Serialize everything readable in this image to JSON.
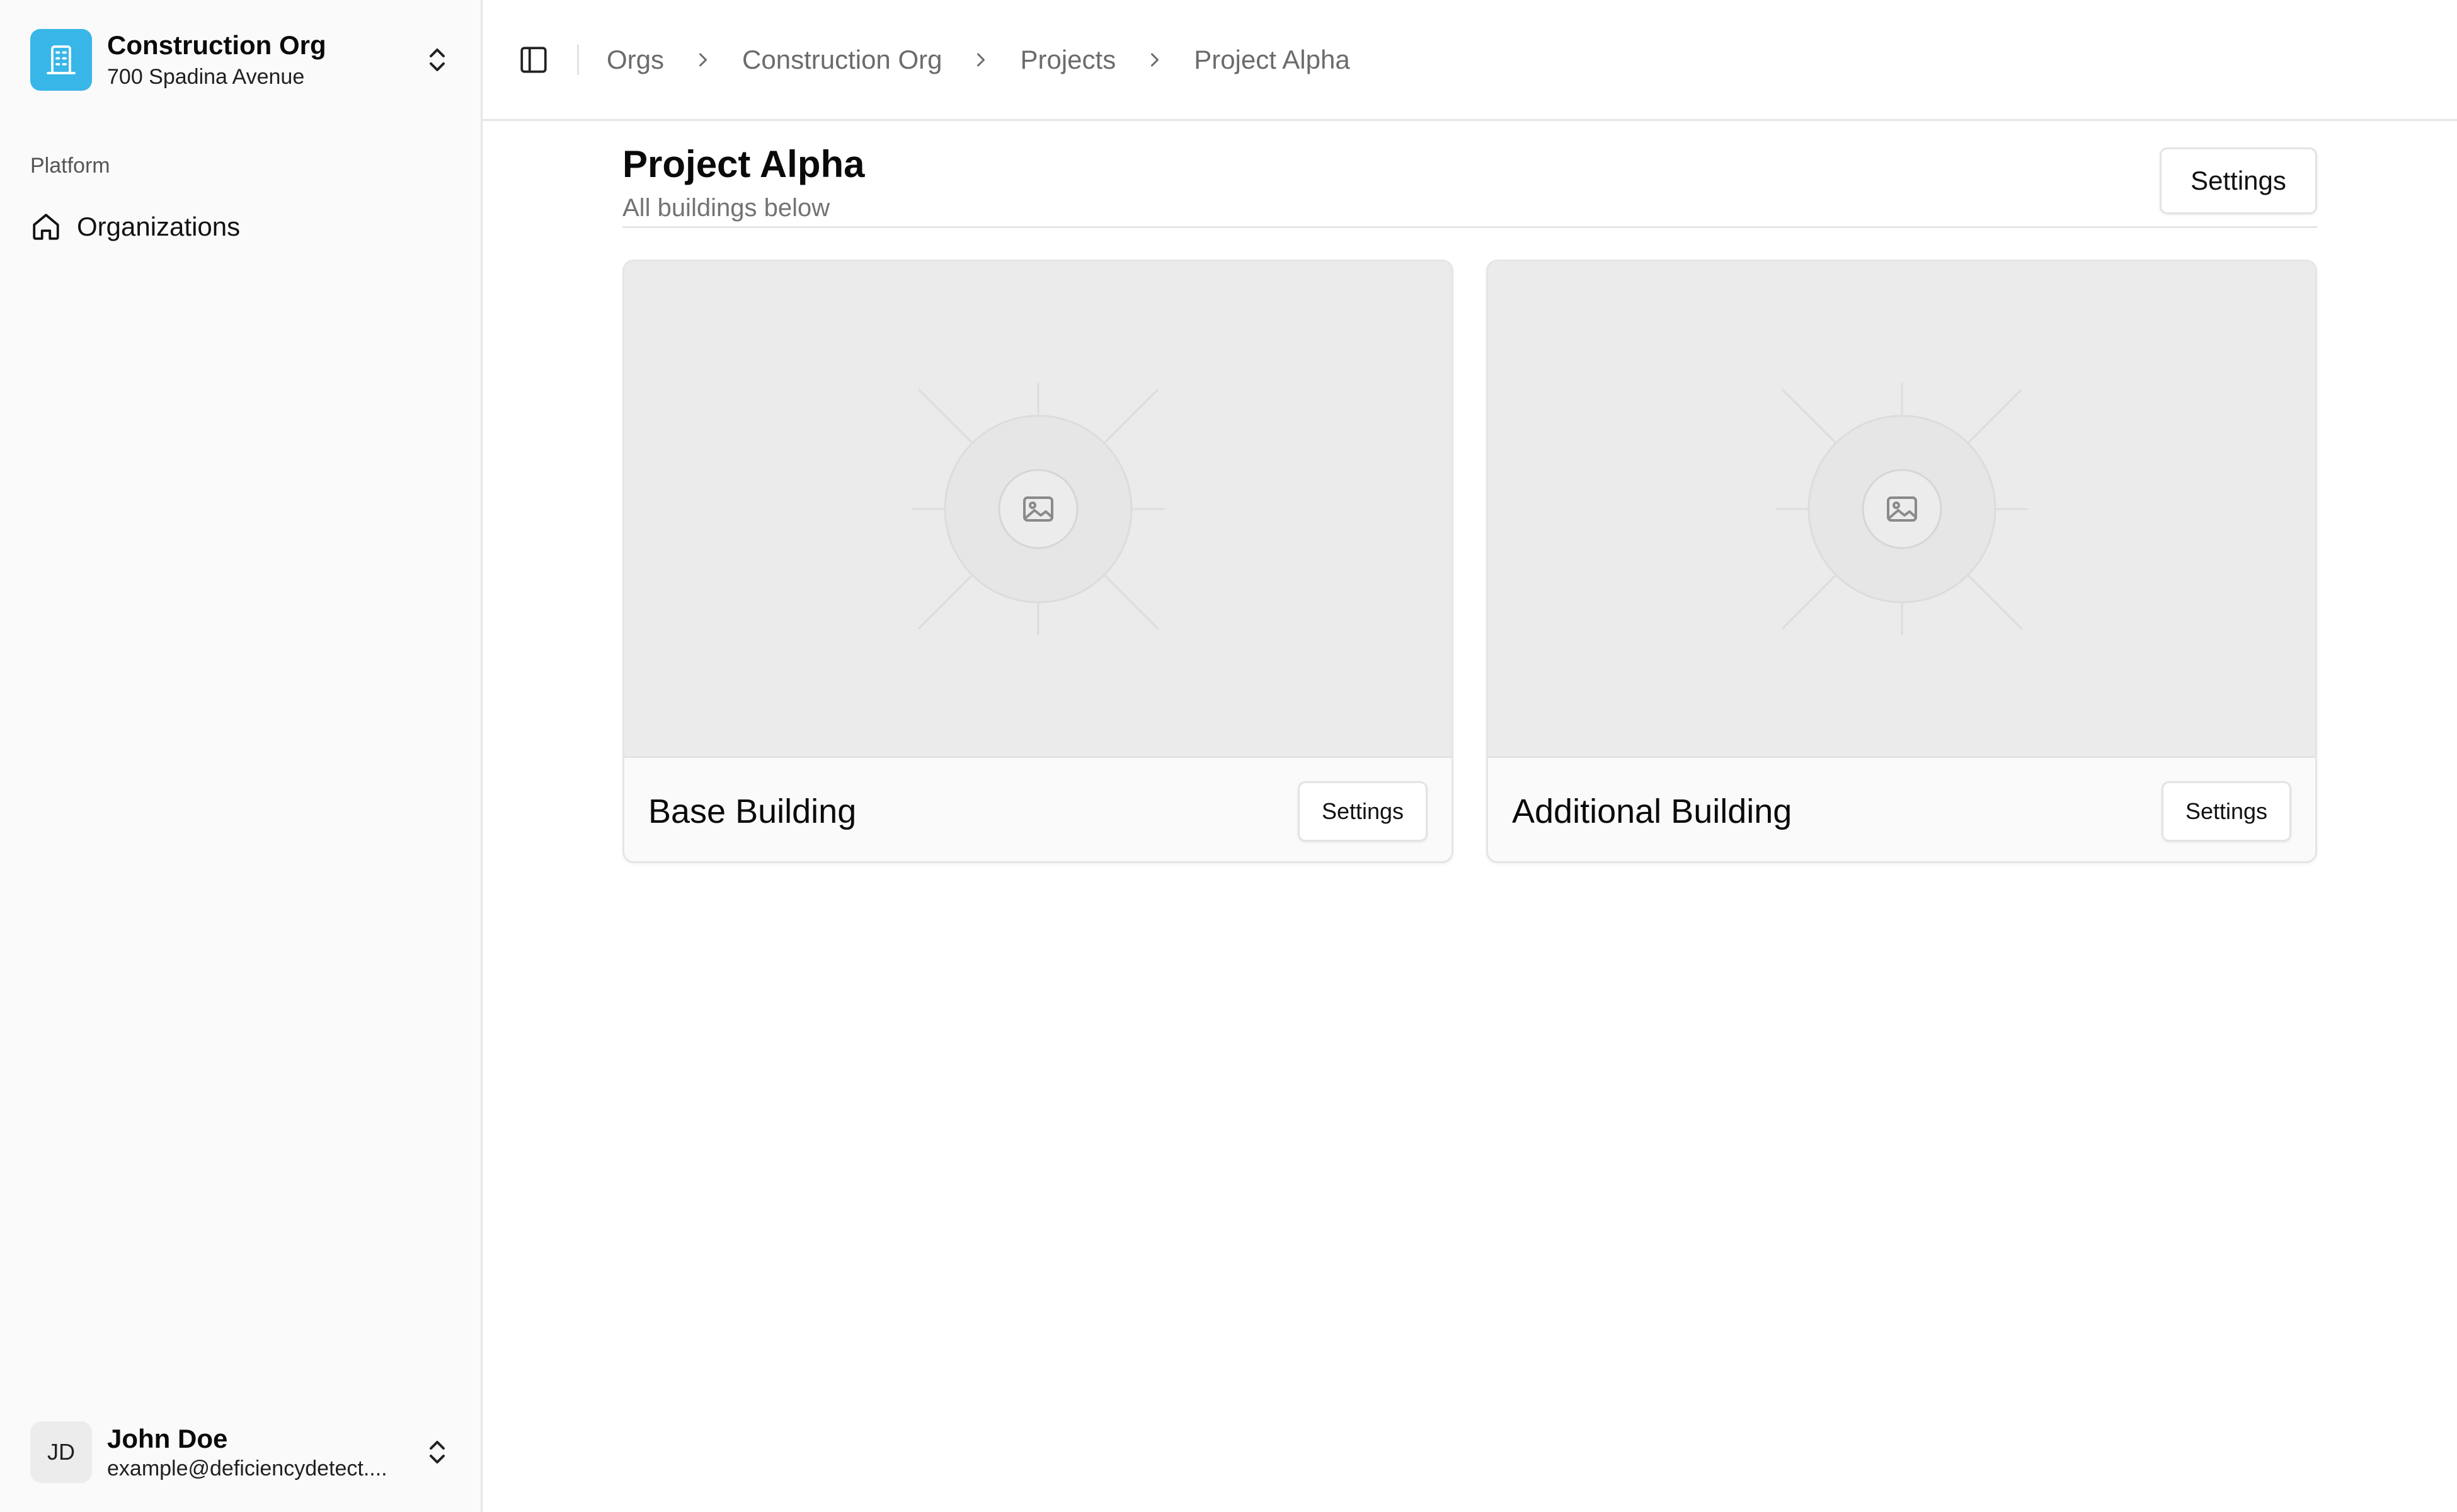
{
  "sidebar": {
    "org": {
      "name": "Construction Org",
      "address": "700 Spadina Avenue"
    },
    "section_label": "Platform",
    "nav_items": [
      {
        "label": "Organizations",
        "icon": "home-icon"
      }
    ],
    "user": {
      "initials": "JD",
      "name": "John Doe",
      "email": "example@deficiencydetect...."
    }
  },
  "topbar": {
    "breadcrumb": [
      "Orgs",
      "Construction Org",
      "Projects",
      "Project Alpha"
    ]
  },
  "page": {
    "title": "Project Alpha",
    "subtitle": "All buildings below",
    "settings_label": "Settings"
  },
  "buildings": [
    {
      "name": "Base Building",
      "settings_label": "Settings"
    },
    {
      "name": "Additional Building",
      "settings_label": "Settings"
    }
  ],
  "colors": {
    "org_logo": "#38b6e8",
    "muted_text": "#737373",
    "border": "#e6e6e6"
  }
}
